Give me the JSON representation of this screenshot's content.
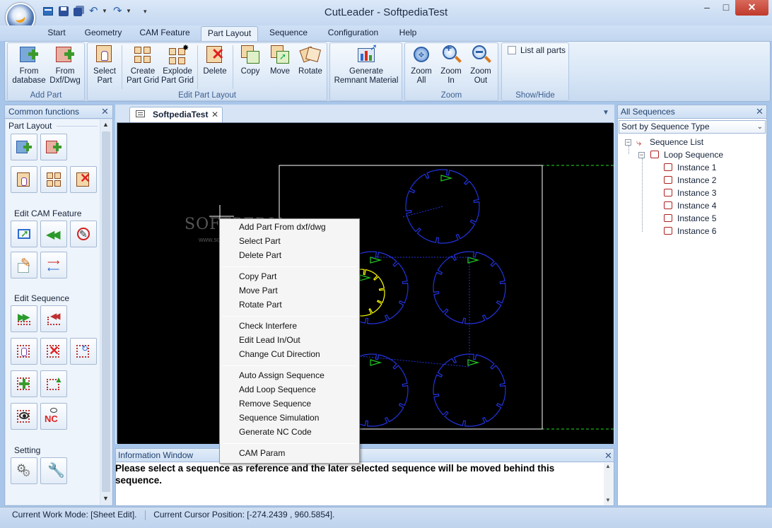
{
  "window": {
    "title": "CutLeader - SoftpediaTest",
    "minimize": "–",
    "maximize": "□",
    "close": "✕"
  },
  "tabs": [
    "Start",
    "Geometry",
    "CAM Feature",
    "Part Layout",
    "Sequence",
    "Configuration",
    "Help"
  ],
  "active_tab": "Part Layout",
  "ribbon": {
    "add_part": {
      "label": "Add Part",
      "from_database": [
        "From",
        "database"
      ],
      "from_dxf": [
        "From",
        "Dxf/Dwg"
      ]
    },
    "edit_part_layout": {
      "label": "Edit Part Layout",
      "select_part": [
        "Select",
        "Part"
      ],
      "create_part_grid": [
        "Create",
        "Part Grid"
      ],
      "explode_part_grid": [
        "Explode",
        "Part Grid"
      ],
      "delete": "Delete",
      "copy": "Copy",
      "move": "Move",
      "rotate": "Rotate"
    },
    "remnant": {
      "generate": [
        "Generate",
        "Remnant Material"
      ]
    },
    "zoom": {
      "label": "Zoom",
      "zoom_all": [
        "Zoom",
        "All"
      ],
      "zoom_in": [
        "Zoom",
        "In"
      ],
      "zoom_out": [
        "Zoom",
        "Out"
      ]
    },
    "show_hide": {
      "label": "Show/Hide",
      "list_all_parts": "List all parts"
    }
  },
  "common_functions": {
    "title": "Common functions",
    "sections": [
      "Part Layout",
      "Edit CAM Feature",
      "Edit Sequence",
      "Setting"
    ],
    "nc_label": "NC"
  },
  "document_tab": {
    "name": "SoftpediaTest"
  },
  "canvas": {
    "watermark": "SOFTPEDIA",
    "watermark_sub": "www.softpedia.com"
  },
  "context_menu": {
    "items": [
      "Add Part From dxf/dwg",
      "Select Part",
      "Delete Part",
      "Copy Part",
      "Move Part",
      "Rotate Part",
      "Check Interfere",
      "Edit Lead In/Out",
      "Change Cut Direction",
      "Auto Assign Sequence",
      "Add Loop Sequence",
      "Remove Sequence",
      "Sequence Simulation",
      "Generate NC Code",
      "CAM Param"
    ]
  },
  "info_window": {
    "title": "Information Window",
    "message": "Please select a sequence as reference and the later selected sequence will be moved behind this sequence."
  },
  "sequences_panel": {
    "title": "All Sequences",
    "sort": "Sort by Sequence Type",
    "root": "Sequence List",
    "loop": "Loop Sequence",
    "instances": [
      "Instance 1",
      "Instance 2",
      "Instance 3",
      "Instance 4",
      "Instance 5",
      "Instance 6"
    ],
    "expand": "−"
  },
  "status": {
    "work_mode": "Current Work Mode: [Sheet Edit].",
    "cursor": "Current Cursor Position: [-274.2439 , 960.5854]."
  },
  "colors": {
    "canvas_bg": "#000000",
    "part_blue": "#2233dd",
    "selected_yellow": "#ffff00",
    "start_green": "#22cc22",
    "sheet_green": "#22dd22"
  }
}
